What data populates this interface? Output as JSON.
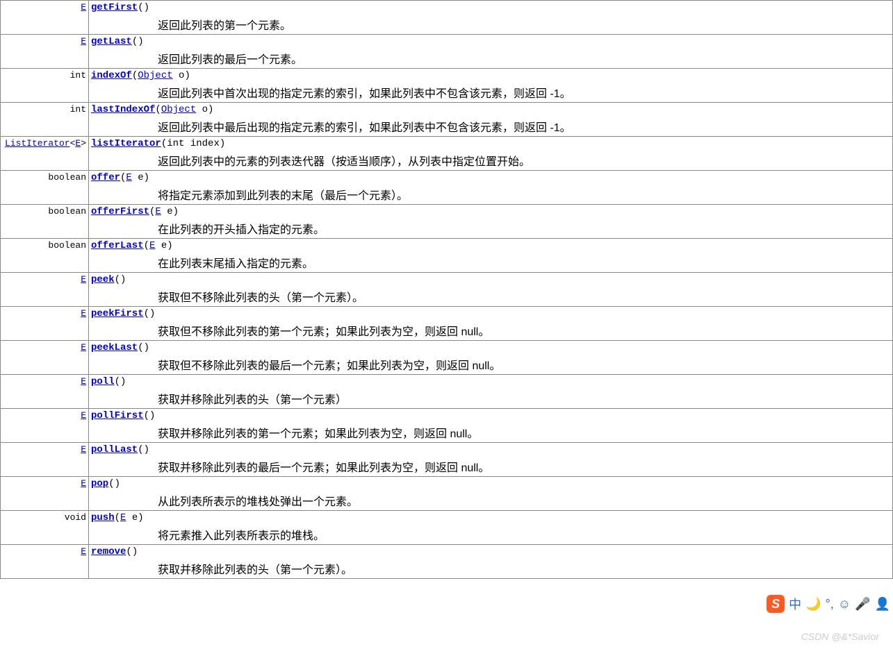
{
  "methods": [
    {
      "return_html": "<a class='type-link' data-name='type-link' data-interactable='true'>E</a>",
      "sig_html": "<a class='method-link' data-name='method-link-getFirst' data-interactable='true'>getFirst</a><span class='paren'>()</span>",
      "desc": "返回此列表的第一个元素。"
    },
    {
      "return_html": "<a class='type-link' data-name='type-link' data-interactable='true'>E</a>",
      "sig_html": "<a class='method-link' data-name='method-link-getLast' data-interactable='true'>getLast</a><span class='paren'>()</span>",
      "desc": "返回此列表的最后一个元素。"
    },
    {
      "return_html": "<span class='paren'>int</span>",
      "sig_html": "<a class='method-link' data-name='method-link-indexOf' data-interactable='true'>indexOf</a><span class='paren'>(</span><a class='param-link' data-name='param-link-Object' data-interactable='true'>Object</a><span class='paren'> o)</span>",
      "desc": "返回此列表中首次出现的指定元素的索引，如果此列表中不包含该元素，则返回 -1。"
    },
    {
      "return_html": "<span class='paren'>int</span>",
      "sig_html": "<a class='method-link' data-name='method-link-lastIndexOf' data-interactable='true'>lastIndexOf</a><span class='paren'>(</span><a class='param-link' data-name='param-link-Object' data-interactable='true'>Object</a><span class='paren'> o)</span>",
      "desc": "返回此列表中最后出现的指定元素的索引，如果此列表中不包含该元素，则返回 -1。"
    },
    {
      "return_html": "<a class='type-link' data-name='type-link' data-interactable='true'>ListIterator</a><span class='paren'>&lt;</span><a class='type-link' data-name='type-link' data-interactable='true'>E</a><span class='paren'>&gt;</span>",
      "sig_html": "<a class='method-link' data-name='method-link-listIterator' data-interactable='true'>listIterator</a><span class='paren'>(int index)</span>",
      "desc": "返回此列表中的元素的列表迭代器（按适当顺序），从列表中指定位置开始。"
    },
    {
      "return_html": "<span class='paren'>boolean</span>",
      "sig_html": "<a class='method-link' data-name='method-link-offer' data-interactable='true'>offer</a><span class='paren'>(</span><a class='param-link' data-name='param-link-E' data-interactable='true'>E</a><span class='paren'> e)</span>",
      "desc": "将指定元素添加到此列表的末尾（最后一个元素）。"
    },
    {
      "return_html": "<span class='paren'>boolean</span>",
      "sig_html": "<a class='method-link' data-name='method-link-offerFirst' data-interactable='true'>offerFirst</a><span class='paren'>(</span><a class='param-link' data-name='param-link-E' data-interactable='true'>E</a><span class='paren'> e)</span>",
      "desc": "在此列表的开头插入指定的元素。"
    },
    {
      "return_html": "<span class='paren'>boolean</span>",
      "sig_html": "<a class='method-link' data-name='method-link-offerLast' data-interactable='true'>offerLast</a><span class='paren'>(</span><a class='param-link' data-name='param-link-E' data-interactable='true'>E</a><span class='paren'> e)</span>",
      "desc": "在此列表末尾插入指定的元素。"
    },
    {
      "return_html": "<a class='type-link' data-name='type-link' data-interactable='true'>E</a>",
      "sig_html": "<a class='method-link' data-name='method-link-peek' data-interactable='true'>peek</a><span class='paren'>()</span>",
      "desc": "获取但不移除此列表的头（第一个元素）。"
    },
    {
      "return_html": "<a class='type-link' data-name='type-link' data-interactable='true'>E</a>",
      "sig_html": "<a class='method-link' data-name='method-link-peekFirst' data-interactable='true'>peekFirst</a><span class='paren'>()</span>",
      "desc": "获取但不移除此列表的第一个元素；如果此列表为空，则返回 null。"
    },
    {
      "return_html": "<a class='type-link' data-name='type-link' data-interactable='true'>E</a>",
      "sig_html": "<a class='method-link' data-name='method-link-peekLast' data-interactable='true'>peekLast</a><span class='paren'>()</span>",
      "desc": "获取但不移除此列表的最后一个元素；如果此列表为空，则返回 null。"
    },
    {
      "return_html": "<a class='type-link' data-name='type-link' data-interactable='true'>E</a>",
      "sig_html": "<a class='method-link' data-name='method-link-poll' data-interactable='true'>poll</a><span class='paren'>()</span>",
      "desc": "获取并移除此列表的头（第一个元素）"
    },
    {
      "return_html": "<a class='type-link' data-name='type-link' data-interactable='true'>E</a>",
      "sig_html": "<a class='method-link' data-name='method-link-pollFirst' data-interactable='true'>pollFirst</a><span class='paren'>()</span>",
      "desc": "获取并移除此列表的第一个元素；如果此列表为空，则返回 null。"
    },
    {
      "return_html": "<a class='type-link' data-name='type-link' data-interactable='true'>E</a>",
      "sig_html": "<a class='method-link' data-name='method-link-pollLast' data-interactable='true'>pollLast</a><span class='paren'>()</span>",
      "desc": "获取并移除此列表的最后一个元素；如果此列表为空，则返回 null。"
    },
    {
      "return_html": "<a class='type-link' data-name='type-link' data-interactable='true'>E</a>",
      "sig_html": "<a class='method-link' data-name='method-link-pop' data-interactable='true'>pop</a><span class='paren'>()</span>",
      "desc": "从此列表所表示的堆栈处弹出一个元素。"
    },
    {
      "return_html": "<span class='paren'>void</span>",
      "sig_html": "<a class='method-link' data-name='method-link-push' data-interactable='true'>push</a><span class='paren'>(</span><a class='param-link' data-name='param-link-E' data-interactable='true'>E</a><span class='paren'> e)</span>",
      "desc": "将元素推入此列表所表示的堆栈。"
    },
    {
      "return_html": "<a class='type-link' data-name='type-link' data-interactable='true'>E</a>",
      "sig_html": "<a class='method-link' data-name='method-link-remove' data-interactable='true'>remove</a><span class='paren'>()</span>",
      "desc": "获取并移除此列表的头（第一个元素）。"
    }
  ],
  "watermark": "CSDN @&*Savior",
  "ime": {
    "logo": "S",
    "items": [
      "中",
      "🌙",
      "°,",
      "☺",
      "🎤",
      "👤"
    ]
  }
}
